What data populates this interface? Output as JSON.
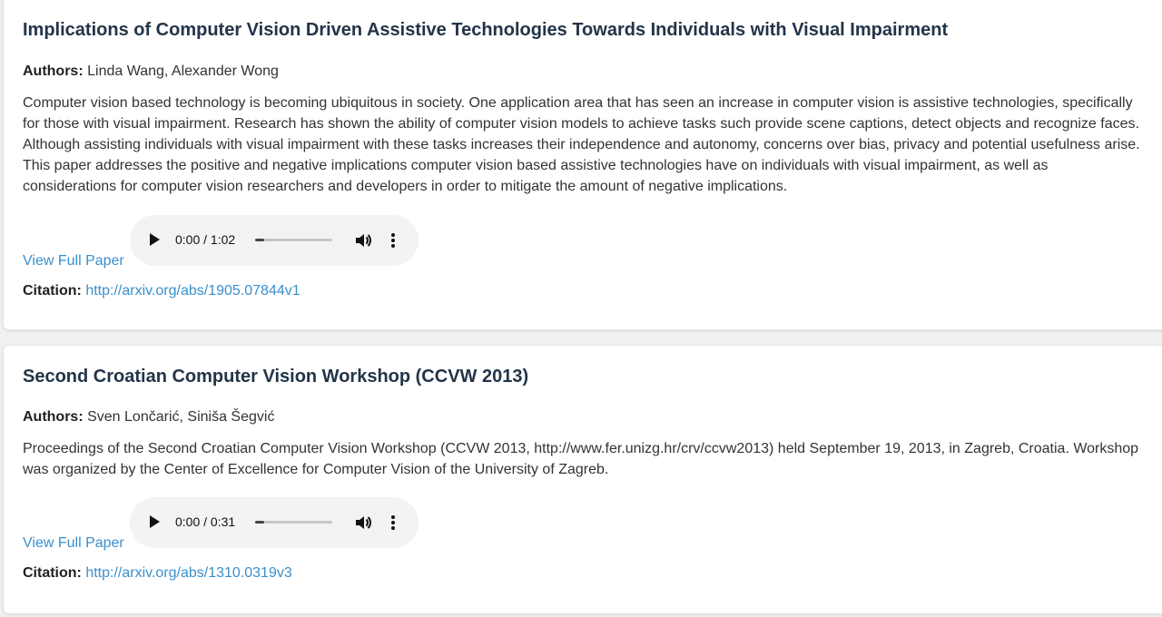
{
  "labels": {
    "authors": "Authors:",
    "citation": "Citation:",
    "view_full_paper": "View Full Paper"
  },
  "papers": [
    {
      "title": "Implications of Computer Vision Driven Assistive Technologies Towards Individuals with Visual Impairment",
      "authors": "Linda Wang, Alexander Wong",
      "abstract": "Computer vision based technology is becoming ubiquitous in society. One application area that has seen an increase in computer vision is assistive technologies, specifically for those with visual impairment. Research has shown the ability of computer vision models to achieve tasks such provide scene captions, detect objects and recognize faces. Although assisting individuals with visual impairment with these tasks increases their independence and autonomy, concerns over bias, privacy and potential usefulness arise. This paper addresses the positive and negative implications computer vision based assistive technologies have on individuals with visual impairment, as well as considerations for computer vision researchers and developers in order to mitigate the amount of negative implications.",
      "audio_time": "0:00 / 1:02",
      "audio_progress": 0.0,
      "citation_url": "http://arxiv.org/abs/1905.07844v1"
    },
    {
      "title": "Second Croatian Computer Vision Workshop (CCVW 2013)",
      "authors": "Sven Lončarić, Siniša Šegvić",
      "abstract": "Proceedings of the Second Croatian Computer Vision Workshop (CCVW 2013, http://www.fer.unizg.hr/crv/ccvw2013) held September 19, 2013, in Zagreb, Croatia. Workshop was organized by the Center of Excellence for Computer Vision of the University of Zagreb.",
      "audio_time": "0:00 / 0:31",
      "audio_progress": 0.0,
      "citation_url": "http://arxiv.org/abs/1310.0319v3"
    }
  ],
  "colors": {
    "title": "#233448",
    "link": "#3a8fcb",
    "player_bg": "#f1f3f4"
  },
  "icons": [
    "play-icon",
    "volume-icon",
    "more-options-icon"
  ]
}
